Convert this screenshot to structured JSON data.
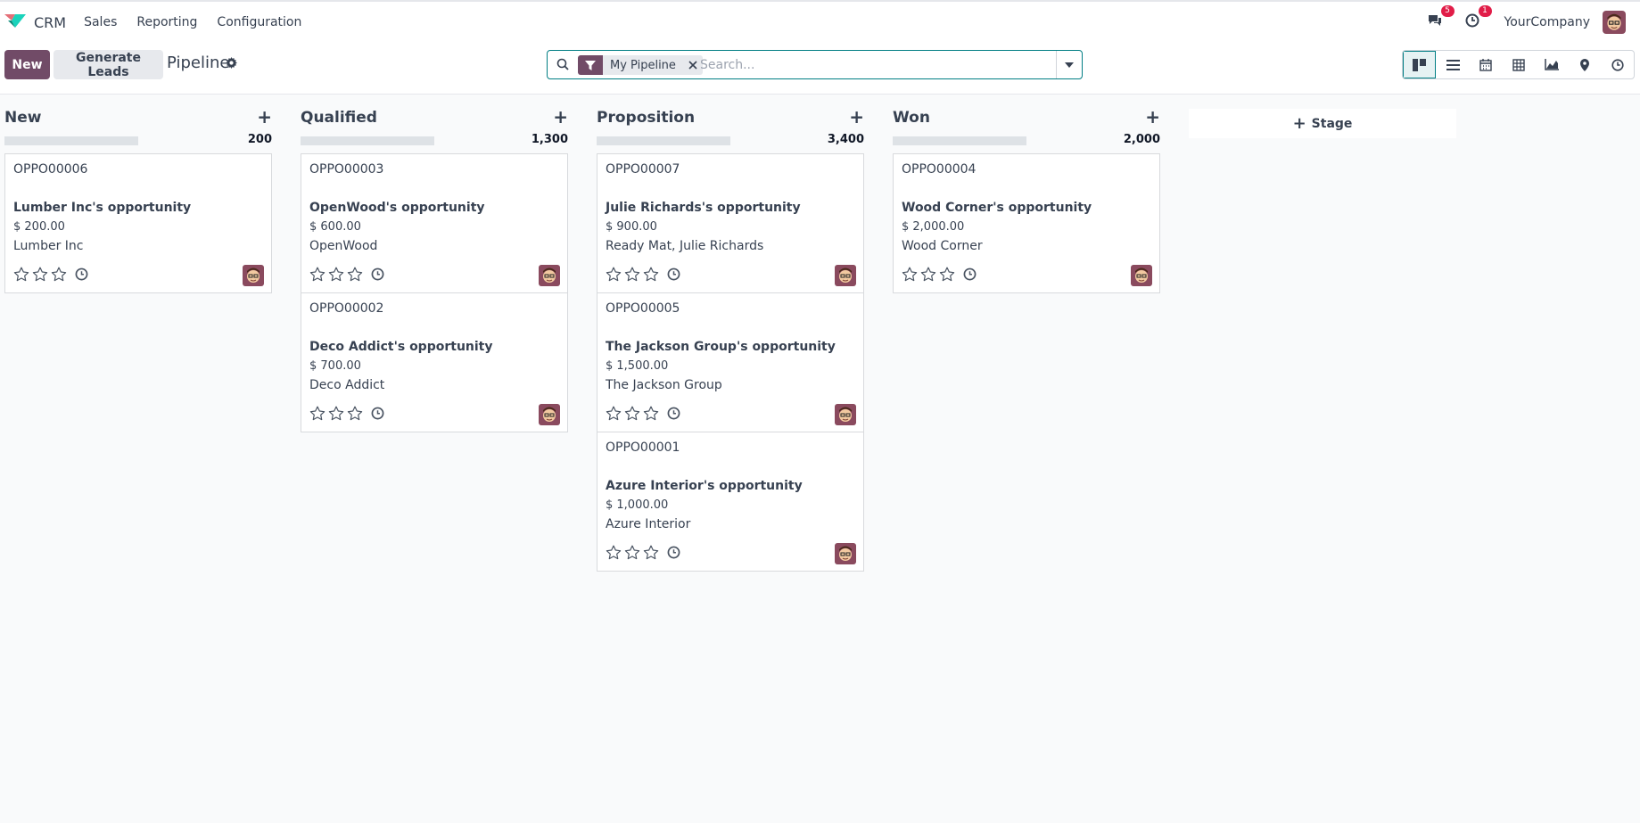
{
  "navbar": {
    "app_name": "CRM",
    "menu": [
      "Sales",
      "Reporting",
      "Configuration"
    ],
    "messages_count": "5",
    "activities_count": "1",
    "company": "YourCompany",
    "brand_color": "#714b67"
  },
  "control": {
    "new_label": "New",
    "generate_label": "Generate Leads",
    "title": "Pipeline",
    "facet_label": "My Pipeline",
    "search_placeholder": "Search...",
    "views": [
      "kanban-icon",
      "list-icon",
      "calendar-icon",
      "pivot-icon",
      "graph-icon",
      "map-icon",
      "activity-icon"
    ]
  },
  "columns": [
    {
      "title": "New",
      "total": "200",
      "cards": [
        {
          "ref": "OPPO00006",
          "name": "Lumber Inc's opportunity",
          "amount": "$ 200.00",
          "partner": "Lumber Inc"
        }
      ]
    },
    {
      "title": "Qualified",
      "total": "1,300",
      "cards": [
        {
          "ref": "OPPO00003",
          "name": "OpenWood's opportunity",
          "amount": "$ 600.00",
          "partner": "OpenWood"
        },
        {
          "ref": "OPPO00002",
          "name": "Deco Addict's opportunity",
          "amount": "$ 700.00",
          "partner": "Deco Addict"
        }
      ]
    },
    {
      "title": "Proposition",
      "total": "3,400",
      "cards": [
        {
          "ref": "OPPO00007",
          "name": "Julie Richards's opportunity",
          "amount": "$ 900.00",
          "partner": "Ready Mat, Julie Richards"
        },
        {
          "ref": "OPPO00005",
          "name": "The Jackson Group's opportunity",
          "amount": "$ 1,500.00",
          "partner": "The Jackson Group"
        },
        {
          "ref": "OPPO00001",
          "name": "Azure Interior's opportunity",
          "amount": "$ 1,000.00",
          "partner": "Azure Interior"
        }
      ]
    },
    {
      "title": "Won",
      "total": "2,000",
      "cards": [
        {
          "ref": "OPPO00004",
          "name": "Wood Corner's opportunity",
          "amount": "$ 2,000.00",
          "partner": "Wood Corner"
        }
      ]
    }
  ],
  "add_stage_label": "Stage"
}
